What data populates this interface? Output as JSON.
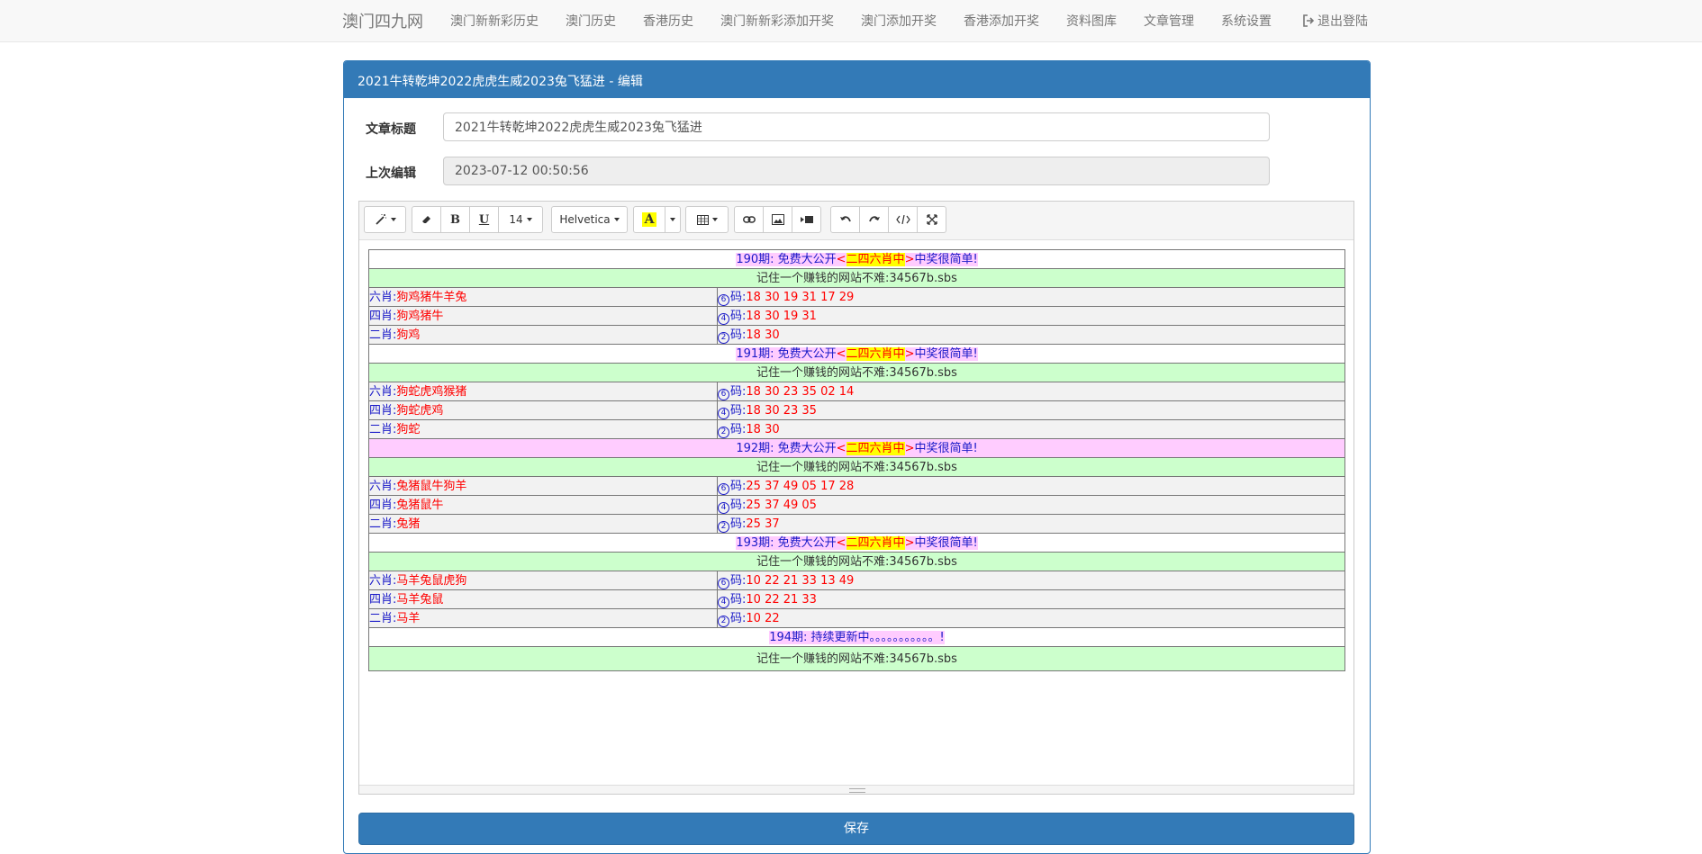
{
  "nav": {
    "brand": "澳门四九网",
    "items": [
      "澳门新新彩历史",
      "澳门历史",
      "香港历史",
      "澳门新新彩添加开奖",
      "澳门添加开奖",
      "香港添加开奖",
      "资料图库",
      "文章管理",
      "系统设置"
    ],
    "logout": "退出登陆"
  },
  "panel": {
    "title": "2021牛转乾坤2022虎虎生威2023兔飞猛进 - 编辑"
  },
  "form": {
    "title_label": "文章标题",
    "title_value": "2021牛转乾坤2022虎虎生威2023兔飞猛进",
    "last_edit_label": "上次编辑",
    "last_edit_value": "2023-07-12 00:50:56"
  },
  "toolbar": {
    "font_size": "14",
    "font_family": "Helvetica",
    "bold": "B",
    "underline": "U",
    "color_glyph": "A"
  },
  "content": {
    "ad_text": "记住一个赚钱的网站不难:34567b.sbs",
    "periods": [
      {
        "head_prefix": "190期: 免费大公开",
        "lt": "<",
        "highlight": "二四六肖中",
        "gt": ">",
        "head_suffix": "中奖很简单!",
        "rows": [
          {
            "zodiac_label": "六肖:",
            "zodiac": "狗鸡猪牛羊兔",
            "circ": "6",
            "num_label": "码:",
            "nums": "18 30 19 31 17 29"
          },
          {
            "zodiac_label": "四肖:",
            "zodiac": "狗鸡猪牛",
            "circ": "4",
            "num_label": "码:",
            "nums": "18 30 19 31"
          },
          {
            "zodiac_label": "二肖:",
            "zodiac": "狗鸡",
            "circ": "2",
            "num_label": "码:",
            "nums": "18 30"
          }
        ]
      },
      {
        "head_prefix": "191期: 免费大公开",
        "lt": "<",
        "highlight": "二四六肖中",
        "gt": ">",
        "head_suffix": "中奖很简单!",
        "rows": [
          {
            "zodiac_label": "六肖:",
            "zodiac": "狗蛇虎鸡猴猪",
            "circ": "6",
            "num_label": "码:",
            "nums": "18 30 23 35 02 14"
          },
          {
            "zodiac_label": "四肖:",
            "zodiac": "狗蛇虎鸡",
            "circ": "4",
            "num_label": "码:",
            "nums": "18 30 23 35"
          },
          {
            "zodiac_label": "二肖:",
            "zodiac": "狗蛇",
            "circ": "2",
            "num_label": "码:",
            "nums": "18 30"
          }
        ]
      },
      {
        "head_prefix": "192期: 免费大公开",
        "lt": "<",
        "highlight": "二四六肖中",
        "gt": ">",
        "head_suffix": "中奖很简单!",
        "rows": [
          {
            "zodiac_label": "六肖:",
            "zodiac": "兔猪鼠牛狗羊",
            "circ": "6",
            "num_label": "码:",
            "nums": "25 37 49 05 17 28"
          },
          {
            "zodiac_label": "四肖:",
            "zodiac": "兔猪鼠牛",
            "circ": "4",
            "num_label": "码:",
            "nums": "25 37 49 05"
          },
          {
            "zodiac_label": "二肖:",
            "zodiac": "兔猪",
            "circ": "2",
            "num_label": "码:",
            "nums": "25 37"
          }
        ]
      },
      {
        "head_prefix": "193期: 免费大公开",
        "lt": "<",
        "highlight": "二四六肖中",
        "gt": ">",
        "head_suffix": "中奖很简单!",
        "rows": [
          {
            "zodiac_label": "六肖:",
            "zodiac": "马羊兔鼠虎狗",
            "circ": "6",
            "num_label": "码:",
            "nums": "10 22 21 33 13 49"
          },
          {
            "zodiac_label": "四肖:",
            "zodiac": "马羊兔鼠",
            "circ": "4",
            "num_label": "码:",
            "nums": "10 22 21 33"
          },
          {
            "zodiac_label": "二肖:",
            "zodiac": "马羊",
            "circ": "2",
            "num_label": "码:",
            "nums": "10 22"
          }
        ]
      }
    ],
    "last_head": "194期: 持续更新中。。。。。。。。。。。!"
  },
  "save_label": "保存",
  "colors": {
    "primary": "#337ab7",
    "highlight": "#ffff00",
    "pink": "#ffccff",
    "green": "#ccffcc"
  }
}
